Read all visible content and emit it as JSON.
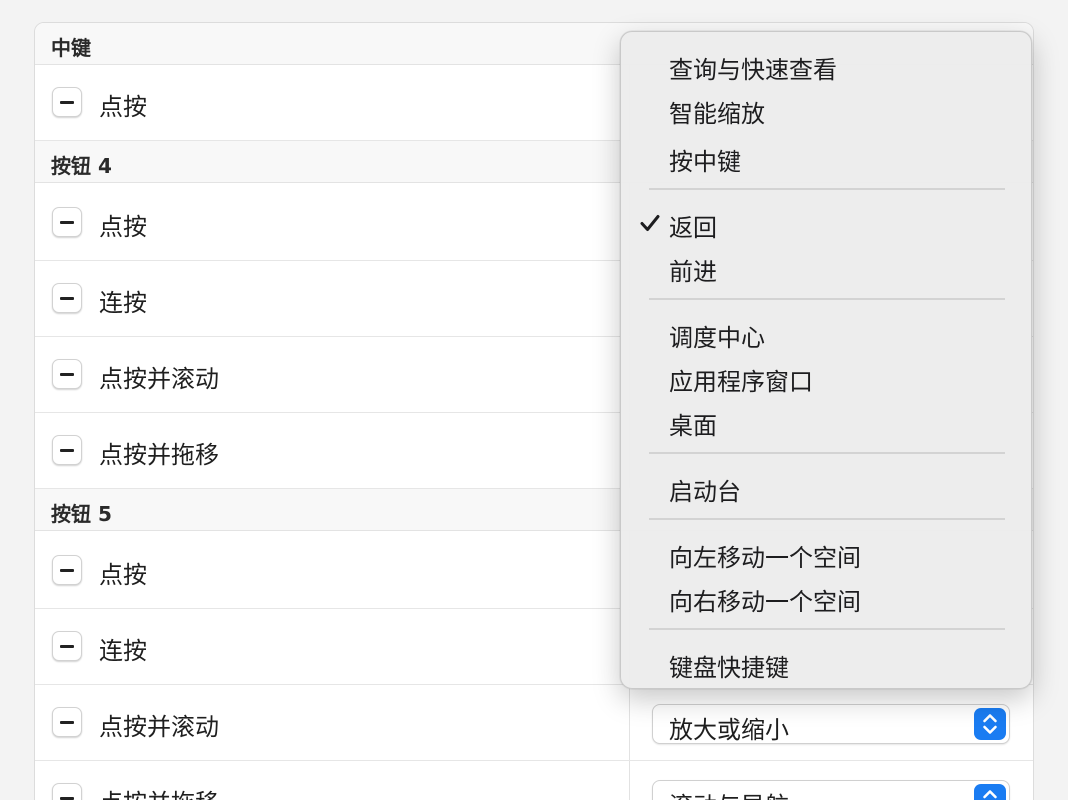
{
  "sections": [
    {
      "title": "中键",
      "rows": [
        {
          "label": "点按"
        }
      ]
    },
    {
      "title": "按钮 4",
      "rows": [
        {
          "label": "点按"
        },
        {
          "label": "连按"
        },
        {
          "label": "点按并滚动"
        },
        {
          "label": "点按并拖移"
        }
      ]
    },
    {
      "title": "按钮 5",
      "rows": [
        {
          "label": "点按"
        },
        {
          "label": "连按"
        },
        {
          "label": "点按并滚动",
          "value": "放大或缩小"
        },
        {
          "label": "点按并拖移",
          "value": "滚动与导航"
        }
      ]
    }
  ],
  "menu": {
    "selected": "返回",
    "items": [
      "查询与快速查看",
      "智能缩放",
      "按中键",
      "返回",
      "前进",
      "调度中心",
      "应用程序窗口",
      "桌面",
      "启动台",
      "向左移动一个空间",
      "向右移动一个空间",
      "键盘快捷键"
    ]
  },
  "colors": {
    "accent": "#1a7cf2",
    "background": "#f3f3f3",
    "menu_background": "#ececec"
  }
}
